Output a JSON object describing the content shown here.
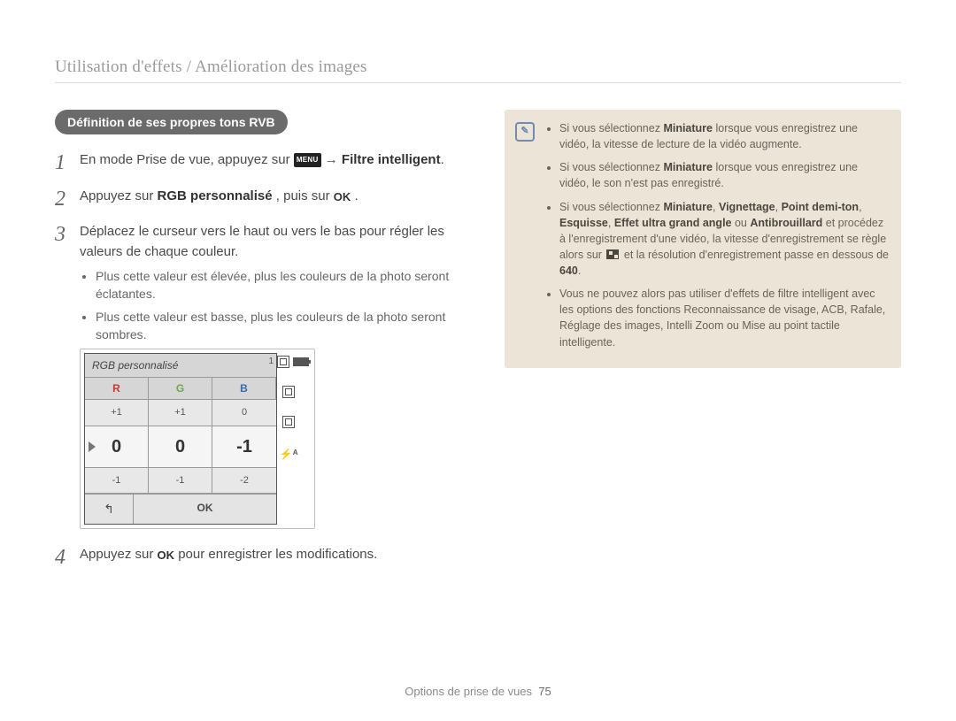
{
  "header": "Utilisation d'effets / Amélioration des images",
  "section_title": "Définition de ses propres tons RVB",
  "menu_label": "MENU",
  "ok_label": "OK",
  "step1": {
    "pre": "En mode Prise de vue, appuyez sur ",
    "arrow": " → ",
    "bold_tail": "Filtre intelligent",
    "tail": "."
  },
  "step2": {
    "pre": "Appuyez sur ",
    "bold": "RGB personnalisé",
    "mid": ", puis sur ",
    "tail": "."
  },
  "step3": {
    "main": "Déplacez le curseur vers le haut ou vers le bas pour régler les valeurs de chaque couleur.",
    "sub": [
      "Plus cette valeur est élevée, plus les couleurs de la photo seront éclatantes.",
      "Plus cette valeur est basse, plus les couleurs de la photo seront sombres."
    ]
  },
  "step4": {
    "pre": "Appuyez sur ",
    "tail": " pour enregistrer les modifications."
  },
  "rgb": {
    "title": "RGB personnalisé",
    "labels": {
      "r": "R",
      "g": "G",
      "b": "B"
    },
    "row_above": {
      "r": "+1",
      "g": "+1",
      "b": "0"
    },
    "row_sel": {
      "r": "0",
      "g": "0",
      "b": "-1"
    },
    "row_below": {
      "r": "-1",
      "g": "-1",
      "b": "-2"
    },
    "back": "↰",
    "ok": "OK",
    "side_one": "1",
    "side_flash": "⚡ᴬ"
  },
  "notes": [
    {
      "pre": "Si vous sélectionnez ",
      "b1": "Miniature",
      "tail": " lorsque vous enregistrez une vidéo, la vitesse de lecture de la vidéo augmente."
    },
    {
      "pre": "Si vous sélectionnez ",
      "b1": "Miniature",
      "tail": " lorsque vous enregistrez une vidéo, le son n'est pas enregistré."
    },
    {
      "pre": "Si vous sélectionnez ",
      "b1": "Miniature",
      "c1": ", ",
      "b2": "Vignettage",
      "c2": ", ",
      "b3": "Point demi-ton",
      "c3": ", ",
      "b4": "Esquisse",
      "c4": ", ",
      "b5": "Effet ultra grand angle",
      "c5": " ou ",
      "b6": "Antibrouillard",
      "mid": " et procédez à l'enregistrement d'une vidéo, la vitesse d'enregistrement se règle alors sur ",
      "mid2": " et la résolution d'enregistrement passe en dessous de ",
      "b7": "640",
      "tail": "."
    },
    {
      "text": "Vous ne pouvez alors pas utiliser d'effets de filtre intelligent avec les options des fonctions Reconnaissance de visage, ACB, Rafale, Réglage des images, Intelli Zoom ou Mise au point tactile intelligente."
    }
  ],
  "footer": {
    "label": "Options de prise de vues",
    "page": "75"
  }
}
